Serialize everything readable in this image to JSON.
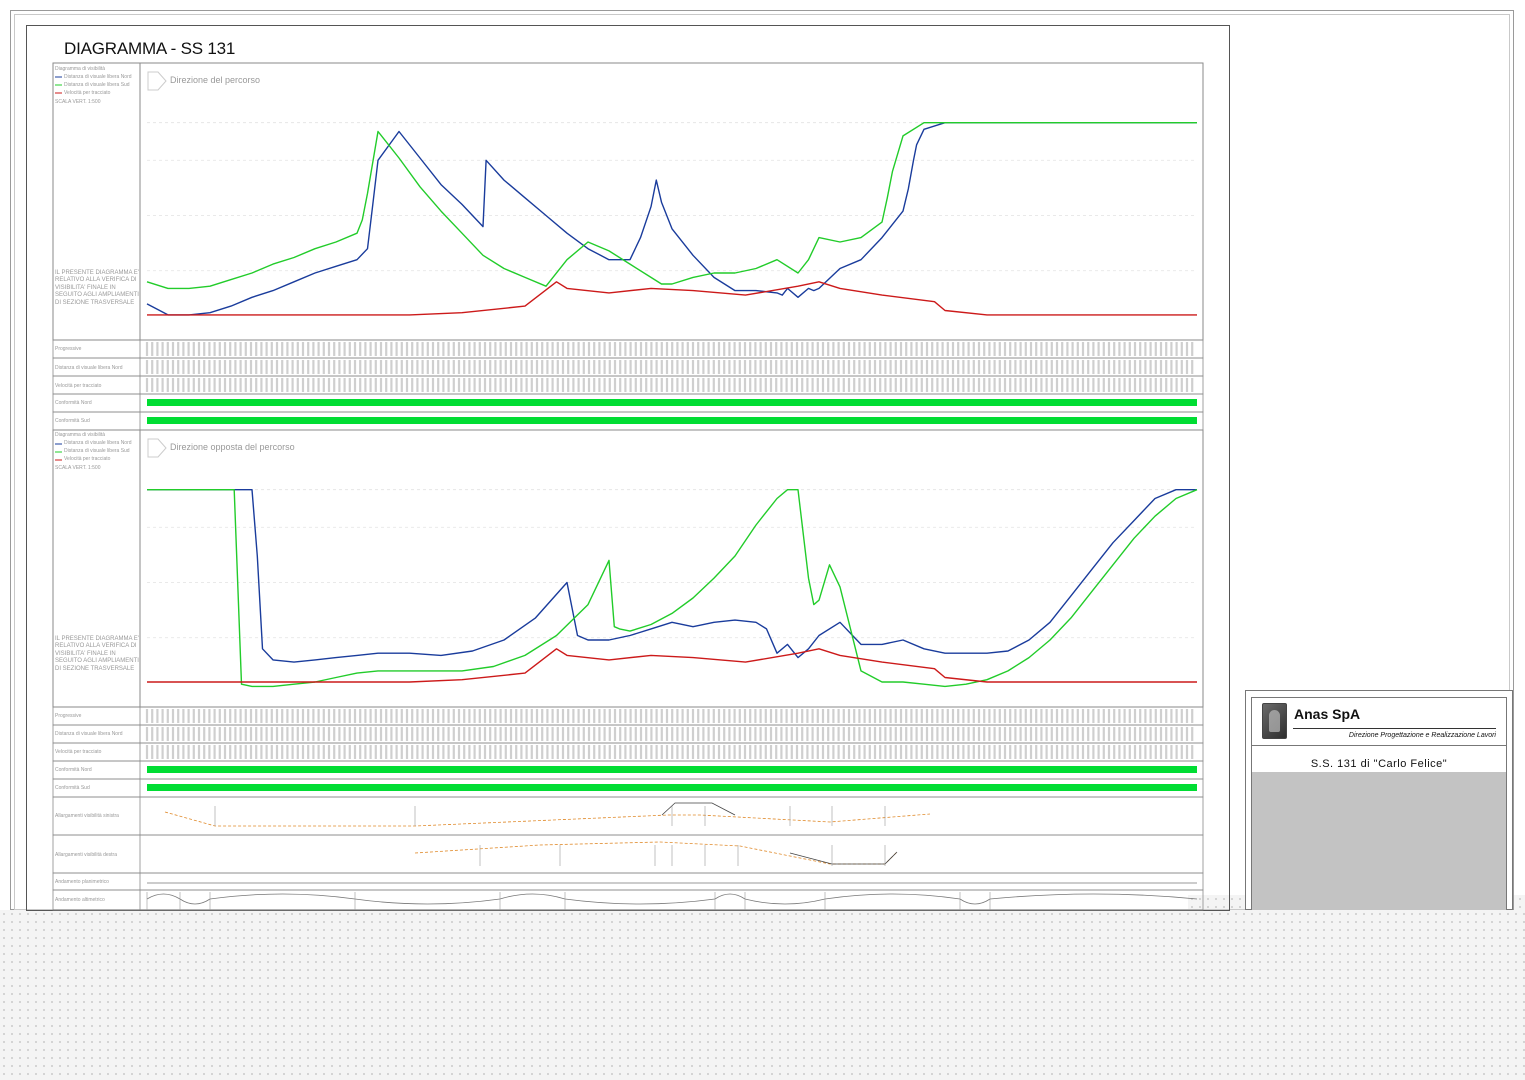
{
  "title": "DIAGRAMMA  - SS 131",
  "panel_top": {
    "direction": "Direzione del percorso",
    "legend": [
      "Diagramma di visibilità",
      "Distanza di visuale libera Nord",
      "Distanza di visuale libera Sud",
      "Velocità per tracciato",
      "SCALA VERT. 1:500"
    ],
    "note": "IL PRESENTE DIAGRAMMA E' RELATIVO ALLA VERIFICA DI VISIBILITA' FINALE IN SEGUITO AGLI AMPLIAMENTI DI SEZIONE TRASVERSALE"
  },
  "panel_bottom": {
    "direction": "Direzione opposta del percorso",
    "legend": [
      "Diagramma di visibilità",
      "Distanza di visuale libera Nord",
      "Distanza di visuale libera Sud",
      "Velocità per tracciato",
      "SCALA VERT. 1:500"
    ],
    "note": "IL PRESENTE DIAGRAMMA E' RELATIVO ALLA VERIFICA DI VISIBILITA' FINALE IN SEGUITO AGLI AMPLIAMENTI DI SEZIONE TRASVERSALE"
  },
  "rows_top": [
    "Progressive",
    "Distanza di visuale libera Nord",
    "Velocità per tracciato",
    "Conformità Nord",
    "Conformità Sud"
  ],
  "rows_bottom": [
    "Progressive",
    "Distanza di visuale libera Nord",
    "Velocità per tracciato",
    "Conformità Nord",
    "Conformità Sud",
    "Allargamenti visibilità sinistra",
    "Allargamenti visibilità destra",
    "Andamento planimetrico",
    "Andamento altimetrico"
  ],
  "colors": {
    "blue": "#1a3c9c",
    "green": "#22cc2a",
    "red": "#cc1a1a",
    "conformity": "#00dd33"
  },
  "title_block": {
    "company": "Anas SpA",
    "department": "Direzione Progettazione e Realizzazione Lavori",
    "road": "S.S. 131 di \"Carlo Felice\""
  },
  "chart_data": [
    {
      "type": "line",
      "title": "Direzione del percorso",
      "series": [
        {
          "name": "Distanza di visuale libera Nord",
          "color": "#1a3c9c",
          "x": [
            0,
            2,
            4,
            6,
            8,
            10,
            12,
            14,
            16,
            18,
            20,
            21,
            21.5,
            22,
            24,
            26,
            28,
            30,
            32,
            32.3,
            34,
            36,
            38,
            40,
            42,
            44,
            46,
            47,
            48,
            48.5,
            49,
            50,
            52,
            54,
            56,
            58,
            60,
            60.5,
            61,
            62,
            63,
            63.5,
            64,
            66,
            68,
            70,
            72,
            72.5,
            73,
            73.3,
            74,
            76,
            100
          ],
          "y": [
            10,
            5,
            5,
            6,
            9,
            13,
            16,
            20,
            24,
            27,
            30,
            35,
            55,
            75,
            88,
            76,
            64,
            55,
            45,
            75,
            66,
            58,
            50,
            42,
            35,
            30,
            30,
            40,
            54,
            66,
            56,
            44,
            32,
            22,
            16,
            16,
            15,
            14,
            17,
            13,
            17,
            16,
            17,
            26,
            30,
            40,
            52,
            62,
            75,
            82,
            89,
            92,
            92
          ]
        },
        {
          "name": "Distanza di visuale libera Sud",
          "color": "#22cc2a",
          "x": [
            0,
            2,
            4,
            6,
            8,
            10,
            12,
            14,
            16,
            18,
            20,
            20.5,
            21,
            22,
            24,
            26,
            28,
            30,
            32,
            34,
            36,
            38,
            40,
            42,
            44,
            46,
            48,
            49,
            50,
            52,
            54,
            56,
            58,
            60,
            62,
            63,
            64,
            66,
            68,
            70,
            70.5,
            71,
            72,
            74,
            100
          ],
          "y": [
            20,
            17,
            17,
            18,
            21,
            24,
            28,
            31,
            35,
            38,
            42,
            48,
            60,
            88,
            76,
            63,
            52,
            42,
            32,
            26,
            22,
            18,
            30,
            38,
            34,
            28,
            22,
            19,
            19,
            22,
            24,
            24,
            26,
            30,
            24,
            30,
            40,
            38,
            40,
            47,
            58,
            70,
            86,
            92,
            92
          ]
        },
        {
          "name": "Velocità per tracciato",
          "color": "#cc1a1a",
          "x": [
            0,
            10,
            20,
            25,
            30,
            36,
            39,
            40,
            44,
            48,
            52,
            57,
            62,
            64,
            66,
            70,
            75,
            76,
            80,
            100
          ],
          "y": [
            5,
            5,
            5,
            5,
            6,
            9,
            20,
            17,
            15,
            17,
            16,
            14,
            18,
            20,
            17,
            14,
            11,
            7,
            5,
            5
          ]
        }
      ]
    },
    {
      "type": "line",
      "title": "Direzione opposta del percorso",
      "series": [
        {
          "name": "Distanza di visuale libera Nord",
          "color": "#1a3c9c",
          "x": [
            0,
            8,
            10,
            10.5,
            11,
            12,
            14,
            16,
            18,
            20,
            22,
            25,
            28,
            31,
            34,
            37,
            40,
            41,
            42,
            44,
            46,
            48,
            50,
            52,
            54,
            56,
            58,
            59,
            60,
            61,
            62,
            63,
            64,
            66,
            68,
            70,
            72,
            74,
            76,
            78,
            80,
            82,
            84,
            86,
            88,
            90,
            92,
            94,
            96,
            98,
            100
          ],
          "y": [
            92,
            92,
            92,
            62,
            20,
            15,
            14,
            15,
            16,
            17,
            18,
            18,
            17,
            19,
            24,
            34,
            50,
            26,
            24,
            24,
            26,
            29,
            32,
            30,
            32,
            33,
            32,
            29,
            18,
            22,
            16,
            20,
            26,
            32,
            22,
            22,
            24,
            20,
            18,
            18,
            18,
            19,
            24,
            32,
            44,
            56,
            68,
            78,
            88,
            92,
            92
          ]
        },
        {
          "name": "Distanza di visuale libera Sud",
          "color": "#22cc2a",
          "x": [
            0,
            8,
            8.3,
            9,
            10,
            12,
            14,
            16,
            18,
            20,
            22,
            25,
            28,
            30,
            33,
            36,
            39,
            42,
            44,
            44.5,
            45,
            46,
            48,
            50,
            52,
            54,
            56,
            58,
            60,
            61,
            62,
            63,
            63.5,
            64,
            65,
            66,
            68,
            70,
            72,
            74,
            76,
            78,
            80,
            82,
            84,
            86,
            88,
            90,
            92,
            94,
            96,
            98,
            100
          ],
          "y": [
            92,
            92,
            92,
            4,
            3,
            3,
            4,
            5,
            7,
            9,
            10,
            10,
            10,
            10,
            12,
            17,
            26,
            40,
            60,
            30,
            29,
            28,
            31,
            36,
            43,
            52,
            62,
            76,
            88,
            92,
            92,
            52,
            40,
            42,
            58,
            48,
            10,
            5,
            5,
            4,
            3,
            4,
            6,
            10,
            16,
            24,
            34,
            46,
            58,
            70,
            80,
            88,
            92
          ]
        },
        {
          "name": "Velocità per tracciato",
          "color": "#cc1a1a",
          "x": [
            0,
            10,
            20,
            25,
            30,
            36,
            39,
            40,
            44,
            48,
            52,
            57,
            62,
            64,
            66,
            70,
            75,
            76,
            80,
            100
          ],
          "y": [
            5,
            5,
            5,
            5,
            6,
            9,
            20,
            17,
            15,
            17,
            16,
            14,
            18,
            20,
            17,
            14,
            11,
            7,
            5,
            5
          ]
        }
      ]
    }
  ]
}
